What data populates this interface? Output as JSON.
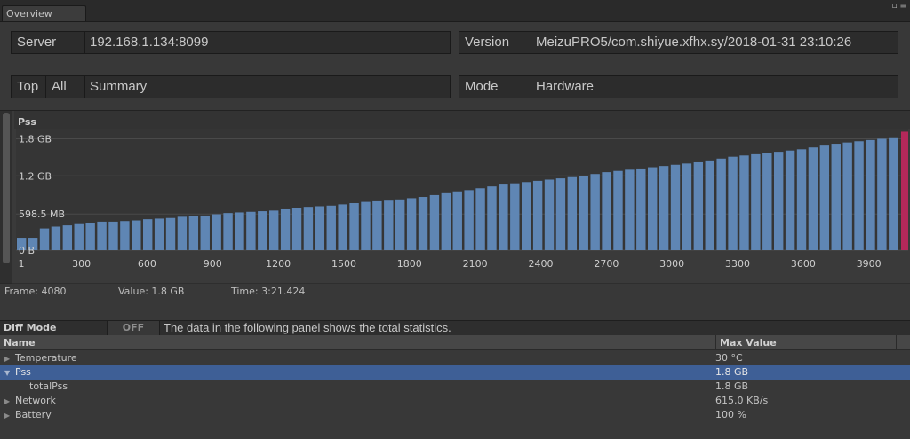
{
  "window": {
    "tab_label": "Overview",
    "controls_label": "▫ ≡"
  },
  "server": {
    "label": "Server",
    "value": "192.168.1.134:8099"
  },
  "version": {
    "label": "Version",
    "value": "MeizuPRO5/com.shiyue.xfhx.sy/2018-01-31 23:10:26"
  },
  "filter": {
    "top_label": "Top",
    "all_label": "All",
    "summary_label": "Summary"
  },
  "mode": {
    "label": "Mode",
    "value": "Hardware"
  },
  "chart_data": {
    "type": "bar",
    "title": "Pss",
    "y_ticks": [
      "1.8 GB",
      "1.2 GB",
      "598.5 MB",
      "0 B"
    ],
    "y_tick_values": [
      1.8,
      1.2,
      0.5845,
      0
    ],
    "ylim": [
      0,
      1.95
    ],
    "y_unit": "GB",
    "x_ticks": [
      "1",
      "300",
      "600",
      "900",
      "1200",
      "1500",
      "1800",
      "2100",
      "2400",
      "2700",
      "3000",
      "3300",
      "3600",
      "3900"
    ],
    "x_tick_values": [
      1,
      300,
      600,
      900,
      1200,
      1500,
      1800,
      2100,
      2400,
      2700,
      3000,
      3300,
      3600,
      3900
    ],
    "xlim": [
      1,
      4080
    ],
    "series": [
      {
        "values": [
          0.2,
          0.2,
          0.35,
          0.38,
          0.4,
          0.42,
          0.44,
          0.46,
          0.46,
          0.47,
          0.48,
          0.5,
          0.51,
          0.52,
          0.54,
          0.55,
          0.56,
          0.58,
          0.6,
          0.61,
          0.62,
          0.63,
          0.64,
          0.66,
          0.68,
          0.7,
          0.71,
          0.72,
          0.74,
          0.76,
          0.78,
          0.79,
          0.8,
          0.82,
          0.84,
          0.86,
          0.89,
          0.92,
          0.95,
          0.97,
          1.0,
          1.03,
          1.06,
          1.08,
          1.1,
          1.12,
          1.14,
          1.16,
          1.18,
          1.2,
          1.23,
          1.26,
          1.28,
          1.3,
          1.32,
          1.34,
          1.36,
          1.38,
          1.4,
          1.42,
          1.45,
          1.48,
          1.51,
          1.53,
          1.55,
          1.57,
          1.59,
          1.61,
          1.63,
          1.66,
          1.69,
          1.72,
          1.74,
          1.76,
          1.78,
          1.8,
          1.81
        ],
        "color": "#5f86b4"
      }
    ],
    "selected_frame": 4080,
    "selected_color": "#b4285a",
    "grid": true
  },
  "status": {
    "frame_text": "Frame: 4080",
    "value_text": "Value: 1.8 GB",
    "time_text": "Time: 3:21.424"
  },
  "diff": {
    "label": "Diff Mode",
    "toggle": "OFF",
    "message": "The data in the following panel shows the total statistics."
  },
  "table": {
    "col_name": "Name",
    "col_max": "Max Value",
    "rows": [
      {
        "name": "Temperature",
        "value": "30 °C"
      },
      {
        "name": "Pss",
        "value": "1.8 GB"
      },
      {
        "name": "totalPss",
        "value": "1.8 GB"
      },
      {
        "name": "Network",
        "value": "615.0 KB/s"
      },
      {
        "name": "Battery",
        "value": "100 %"
      }
    ]
  }
}
